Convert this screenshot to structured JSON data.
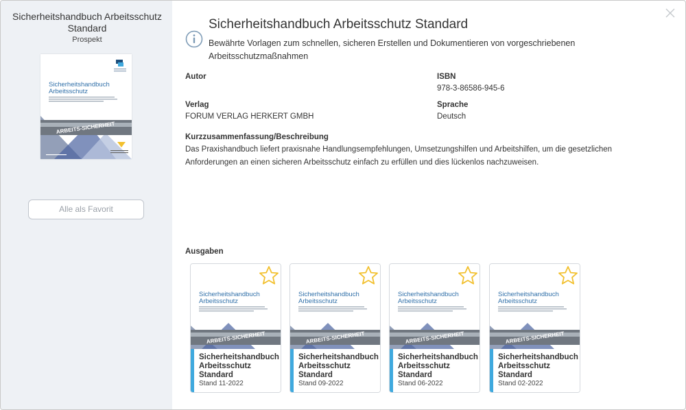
{
  "sidebar": {
    "title": "Sicherheitshandbuch Arbeitsschutz Standard",
    "subtitle": "Prospekt",
    "cover": {
      "title_line1": "Sicherheitshandbuch",
      "title_line2": "Arbeitsschutz",
      "banner_text": "ARBEITS-SICHERHEIT"
    },
    "fav_all_label": "Alle als Favorit"
  },
  "main": {
    "title": "Sicherheitshandbuch Arbeitsschutz Standard",
    "subtitle": "Bewährte Vorlagen zum schnellen, sicheren Erstellen und Dokumentieren von vorgeschriebenen Arbeitsschutzmaßnahmen",
    "author_label": "Autor",
    "author_value": "",
    "isbn_label": "ISBN",
    "isbn_value": "978-3-86586-945-6",
    "publisher_label": "Verlag",
    "publisher_value": "FORUM VERLAG HERKERT GMBH",
    "language_label": "Sprache",
    "language_value": "Deutsch",
    "summary_label": "Kurzzusammenfassung/Beschreibung",
    "summary_text": "Das Praxishandbuch liefert praxisnahe Handlungsempfehlungen, Umsetzungshilfen und Arbeitshilfen, um die gesetzlichen Anforderungen an einen sicheren Arbeitsschutz einfach zu erfüllen und dies lückenlos nachzuweisen.",
    "editions_label": "Ausgaben"
  },
  "editions": [
    {
      "title": "Sicherheitshandbuch Arbeitsschutz Standard",
      "stand": "Stand 11-2022"
    },
    {
      "title": "Sicherheitshandbuch Arbeitsschutz Standard",
      "stand": "Stand 09-2022"
    },
    {
      "title": "Sicherheitshandbuch Arbeitsschutz Standard",
      "stand": "Stand 06-2022"
    },
    {
      "title": "Sicherheitshandbuch Arbeitsschutz Standard",
      "stand": "Stand 02-2022"
    }
  ],
  "icons": {
    "info": "info-icon",
    "close": "close-icon",
    "favorite": "star-icon"
  },
  "colors": {
    "sidebar_bg": "#eef1f5",
    "accent_blue": "#3fa9de",
    "star": "#f2c02e",
    "cover_blue": "#2f6fa8"
  }
}
